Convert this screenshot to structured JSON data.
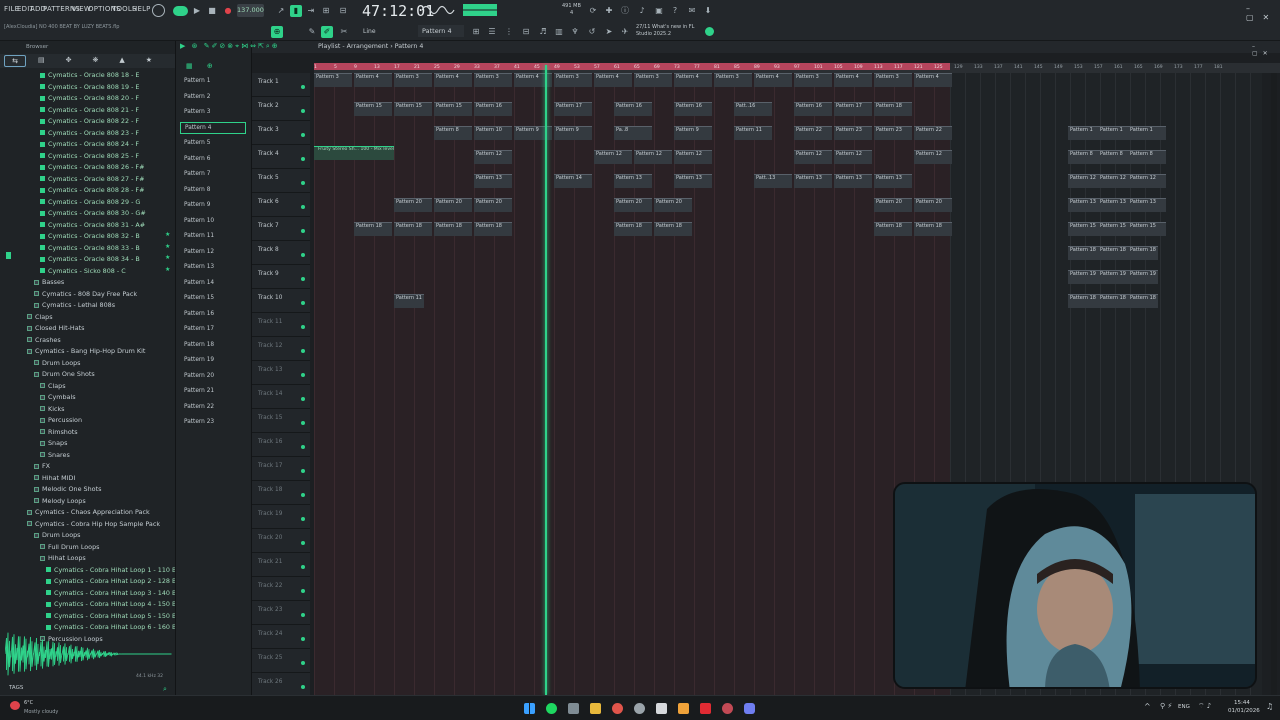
{
  "menu": [
    "FILE",
    "EDIT",
    "ADD",
    "PATTERNS",
    "VIEW",
    "OPTIONS",
    "TOOLS",
    "HELP"
  ],
  "tempo": "137.000",
  "time_display": "47:12:01",
  "cpu_ram": "491 MB",
  "cpu_count": "4",
  "project_title": "[AlexCloudia] NO 400 BEAT BY LUZY BEATS.flp",
  "breadcrumb": "Playlist - Arrangement › Pattern 4",
  "pattern_selector": "Pattern 4",
  "snap_mode": "Line",
  "news": {
    "line1": "27/11 What's new in FL",
    "line2": "Studio 2025.2"
  },
  "browser_header": "Browser",
  "browser_items": [
    {
      "label": "Cymatics - Oracle 808 18 - E",
      "folder": false
    },
    {
      "label": "Cymatics - Oracle 808 19 - E",
      "folder": false
    },
    {
      "label": "Cymatics - Oracle 808 20 - F",
      "folder": false
    },
    {
      "label": "Cymatics - Oracle 808 21 - F",
      "folder": false
    },
    {
      "label": "Cymatics - Oracle 808 22 - F",
      "folder": false
    },
    {
      "label": "Cymatics - Oracle 808 23 - F",
      "folder": false
    },
    {
      "label": "Cymatics - Oracle 808 24 - F",
      "folder": false
    },
    {
      "label": "Cymatics - Oracle 808 25 - F",
      "folder": false
    },
    {
      "label": "Cymatics - Oracle 808 26 - F#",
      "folder": false
    },
    {
      "label": "Cymatics - Oracle 808 27 - F#",
      "folder": false
    },
    {
      "label": "Cymatics - Oracle 808 28 - F#",
      "folder": false
    },
    {
      "label": "Cymatics - Oracle 808 29 - G",
      "folder": false
    },
    {
      "label": "Cymatics - Oracle 808 30 - G#",
      "folder": false
    },
    {
      "label": "Cymatics - Oracle 808 31 - A#",
      "folder": false
    },
    {
      "label": "Cymatics - Oracle 808 32 - B",
      "folder": false
    },
    {
      "label": "Cymatics - Oracle 808 33 - B",
      "folder": false
    },
    {
      "label": "Cymatics - Oracle 808 34 - B",
      "folder": false
    },
    {
      "label": "Cymatics - Sicko 808 - C",
      "folder": false
    },
    {
      "label": "Basses",
      "folder": true
    },
    {
      "label": "Cymatics - 808 Day Free Pack",
      "folder": true
    },
    {
      "label": "Cymatics - Lethal 808s",
      "folder": true
    },
    {
      "label": "Claps",
      "folder": true
    },
    {
      "label": "Closed Hit-Hats",
      "folder": true
    },
    {
      "label": "Crashes",
      "folder": true
    },
    {
      "label": "Cymatics - Bang Hip-Hop Drum Kit",
      "folder": true
    },
    {
      "label": "Drum Loops",
      "folder": true
    },
    {
      "label": "Drum One Shots",
      "folder": true
    },
    {
      "label": "Claps",
      "folder": true
    },
    {
      "label": "Cymbals",
      "folder": true
    },
    {
      "label": "Kicks",
      "folder": true
    },
    {
      "label": "Percussion",
      "folder": true
    },
    {
      "label": "Rimshots",
      "folder": true
    },
    {
      "label": "Snaps",
      "folder": true
    },
    {
      "label": "Snares",
      "folder": true
    },
    {
      "label": "FX",
      "folder": true
    },
    {
      "label": "Hihat MIDI",
      "folder": true
    },
    {
      "label": "Melodic One Shots",
      "folder": true
    },
    {
      "label": "Melody Loops",
      "folder": true
    },
    {
      "label": "Cymatics - Chaos Appreciation Pack",
      "folder": true
    },
    {
      "label": "Cymatics - Cobra Hip Hop Sample Pack",
      "folder": true
    },
    {
      "label": "Drum Loops",
      "folder": true
    },
    {
      "label": "Full Drum Loops",
      "folder": true
    },
    {
      "label": "Hihat Loops",
      "folder": true
    },
    {
      "label": "Cymatics - Cobra Hihat Loop 1 - 110 BPM",
      "folder": false
    },
    {
      "label": "Cymatics - Cobra Hihat Loop 2 - 128 BPM",
      "folder": false
    },
    {
      "label": "Cymatics - Cobra Hihat Loop 3 - 140 BPM",
      "folder": false
    },
    {
      "label": "Cymatics - Cobra Hihat Loop 4 - 150 BPM",
      "folder": false
    },
    {
      "label": "Cymatics - Cobra Hihat Loop 5 - 150 BPM",
      "folder": false
    },
    {
      "label": "Cymatics - Cobra Hihat Loop 6 - 160 BPM",
      "folder": false
    },
    {
      "label": "Percussion Loops",
      "folder": true
    }
  ],
  "waveform_info": "44.1 kHz 32",
  "tags_label": "TAGS",
  "patterns": [
    "Pattern 1",
    "Pattern 2",
    "Pattern 3",
    "Pattern 4",
    "Pattern 5",
    "Pattern 6",
    "Pattern 7",
    "Pattern 8",
    "Pattern 9",
    "Pattern 10",
    "Pattern 11",
    "Pattern 12",
    "Pattern 13",
    "Pattern 14",
    "Pattern 15",
    "Pattern 16",
    "Pattern 17",
    "Pattern 18",
    "Pattern 19",
    "Pattern 20",
    "Pattern 21",
    "Pattern 22",
    "Pattern 23"
  ],
  "selected_pattern": 3,
  "tracks": [
    "Track 1",
    "Track 2",
    "Track 3",
    "Track 4",
    "Track 5",
    "Track 6",
    "Track 7",
    "Track 8",
    "Track 9",
    "Track 10",
    "Track 11",
    "Track 12",
    "Track 13",
    "Track 14",
    "Track 15",
    "Track 16",
    "Track 17",
    "Track 18",
    "Track 19",
    "Track 20",
    "Track 21",
    "Track 22",
    "Track 23",
    "Track 24",
    "Track 25",
    "Track 26"
  ],
  "automation_clip": "Fruity Stereo Sh... 100 - Mix level",
  "clips": {
    "track1": [
      "Pattern 3",
      "Pattern 4",
      "Pattern 3",
      "Pattern 4",
      "Pattern 3",
      "Pattern 4",
      "Pattern 3",
      "Pattern 4",
      "Pattern 3",
      "Pattern 4",
      "Pattern 3",
      "Pattern 4",
      "Pattern 3",
      "Pattern 4",
      "Pattern 3",
      "Pattern 4"
    ],
    "track2": [
      "Pattern 15",
      "Pattern 15",
      "Pattern 15",
      "Pattern 16",
      "Pattern 17",
      "Pattern 16",
      "Pattern 16",
      "Patt..16",
      "Pattern 16",
      "Pattern 17",
      "Pattern 18"
    ],
    "track3": [
      "Pattern 8",
      "Pattern 10",
      "Pattern 9",
      "Pattern 9",
      "Pa..8",
      "Pattern 9",
      "Pattern 11",
      "Pattern 22",
      "Pattern 23",
      "Pattern 23",
      "Pattern 22",
      "Pattern 1",
      "Pattern 1",
      "Pattern 1"
    ],
    "track4": [
      "Pattern 12",
      "Pattern 12",
      "Pattern 12",
      "Pattern 12",
      "Pattern 12",
      "Pattern 12",
      "Pattern 12",
      "Pattern 8",
      "Pattern 8",
      "Pattern 8"
    ],
    "track5": [
      "Pattern 13",
      "Pattern 14",
      "Pattern 13",
      "Pattern 13",
      "Patt..13",
      "Pattern 13",
      "Pattern 13",
      "Pattern 13",
      "Pattern 12",
      "Pattern 12",
      "Pattern 12"
    ],
    "track6": [
      "Pattern 20",
      "Pattern 20",
      "Pattern 20",
      "Pattern 20",
      "Pattern 20",
      "Pattern 20",
      "Pattern 20",
      "Pattern 13",
      "Pattern 13",
      "Pattern 13"
    ],
    "track7": [
      "Pattern 18",
      "Pattern 18",
      "Pattern 18",
      "Pattern 18",
      "Pattern 18",
      "Pattern 18",
      "Pattern 18",
      "Pattern 18",
      "Pattern 15",
      "Pattern 15",
      "Pattern 15"
    ],
    "track8": [
      "Pattern 18",
      "Pattern 18",
      "Pattern 18"
    ],
    "track9": [
      "Pattern 19",
      "Pattern 19",
      "Pattern 19"
    ],
    "track10": [
      "Pattern 11",
      "Pattern 18",
      "Pattern 18",
      "Pattern 18"
    ]
  },
  "ruler_numbers": [
    "1",
    "5",
    "9",
    "13",
    "17",
    "21",
    "25",
    "29",
    "33",
    "37",
    "41",
    "45",
    "49",
    "53",
    "57",
    "61",
    "65",
    "69",
    "73",
    "77",
    "81",
    "85",
    "89",
    "93",
    "97",
    "101",
    "105",
    "109",
    "113",
    "117",
    "121",
    "125",
    "129",
    "133",
    "137",
    "141",
    "145",
    "149",
    "153",
    "157",
    "161",
    "165",
    "169",
    "173",
    "177",
    "181"
  ],
  "weather": {
    "temp": "6°C",
    "desc": "Mostly cloudy"
  },
  "tray": {
    "lang": "ENG",
    "time": "15:44",
    "date": "01/01/2026"
  }
}
